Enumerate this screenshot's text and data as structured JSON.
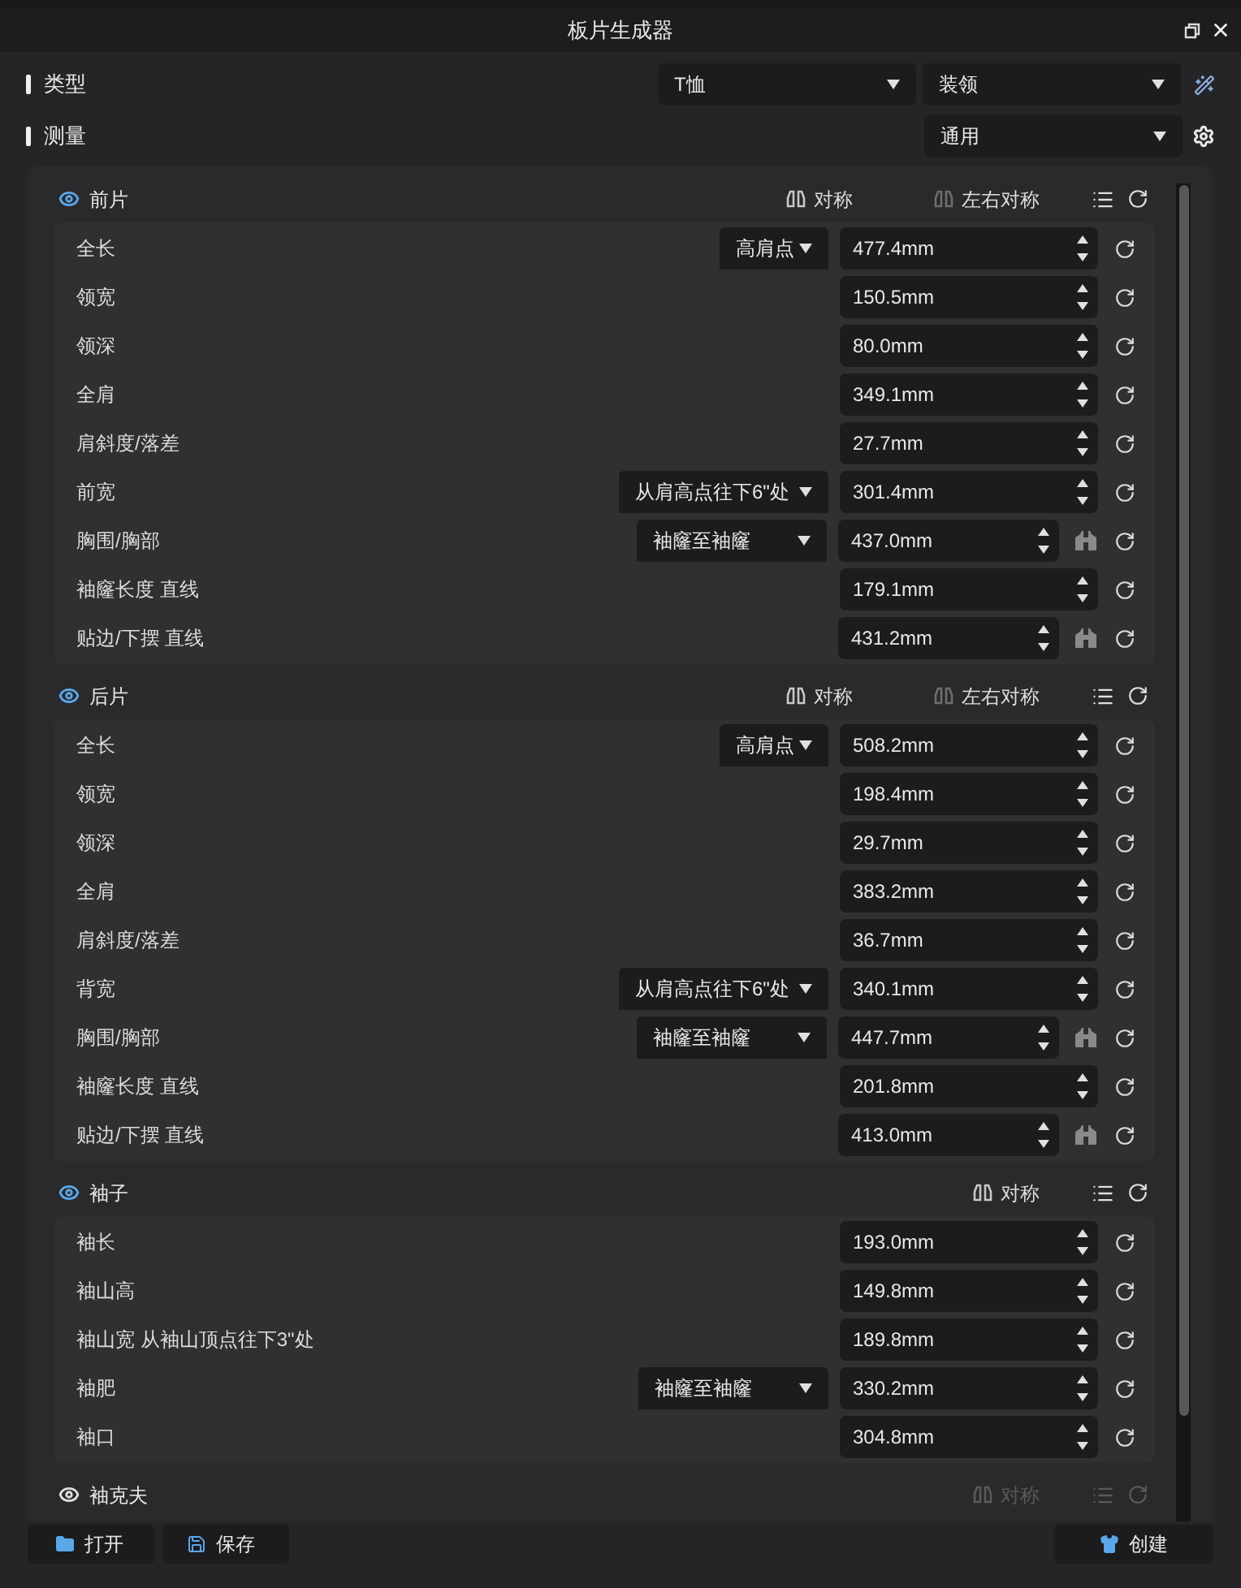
{
  "window": {
    "title": "板片生成器"
  },
  "type_row": {
    "label": "类型",
    "garment": "T恤",
    "collar": "装领"
  },
  "measure_row": {
    "label": "测量",
    "preset": "通用"
  },
  "sections": [
    {
      "title": "前片",
      "enabled": true,
      "toggles": [
        {
          "label": "对称",
          "on": true
        },
        {
          "label": "左右对称",
          "on": false
        }
      ],
      "rows": [
        {
          "label": "全长",
          "option": "高肩点",
          "value": "477.4mm",
          "figure": false
        },
        {
          "label": "领宽",
          "value": "150.5mm",
          "figure": false
        },
        {
          "label": "领深",
          "value": "80.0mm",
          "figure": false
        },
        {
          "label": "全肩",
          "value": "349.1mm",
          "figure": false
        },
        {
          "label": "肩斜度/落差",
          "value": "27.7mm",
          "figure": false
        },
        {
          "label": "前宽",
          "option": "从肩高点往下6\"处",
          "value": "301.4mm",
          "figure": false
        },
        {
          "label": "胸围/胸部",
          "option": "袖窿至袖窿",
          "value": "437.0mm",
          "figure": true
        },
        {
          "label": "袖窿长度 直线",
          "value": "179.1mm",
          "figure": false
        },
        {
          "label": "贴边/下摆 直线",
          "value": "431.2mm",
          "figure": true
        }
      ]
    },
    {
      "title": "后片",
      "enabled": true,
      "toggles": [
        {
          "label": "对称",
          "on": true
        },
        {
          "label": "左右对称",
          "on": false
        }
      ],
      "rows": [
        {
          "label": "全长",
          "option": "高肩点",
          "value": "508.2mm",
          "figure": false
        },
        {
          "label": "领宽",
          "value": "198.4mm",
          "figure": false
        },
        {
          "label": "领深",
          "value": "29.7mm",
          "figure": false
        },
        {
          "label": "全肩",
          "value": "383.2mm",
          "figure": false
        },
        {
          "label": "肩斜度/落差",
          "value": "36.7mm",
          "figure": false
        },
        {
          "label": "背宽",
          "option": "从肩高点往下6\"处",
          "value": "340.1mm",
          "figure": false
        },
        {
          "label": "胸围/胸部",
          "option": "袖窿至袖窿",
          "value": "447.7mm",
          "figure": true
        },
        {
          "label": "袖窿长度 直线",
          "value": "201.8mm",
          "figure": false
        },
        {
          "label": "贴边/下摆 直线",
          "value": "413.0mm",
          "figure": true
        }
      ]
    },
    {
      "title": "袖子",
      "enabled": true,
      "toggles": [
        {
          "label": "对称",
          "on": true
        }
      ],
      "rows": [
        {
          "label": "袖长",
          "value": "193.0mm",
          "figure": false
        },
        {
          "label": "袖山高",
          "value": "149.8mm",
          "figure": false
        },
        {
          "label": "袖山宽 从袖山顶点往下3\"处",
          "value": "189.8mm",
          "figure": false
        },
        {
          "label": "袖肥",
          "option": "袖窿至袖窿",
          "value": "330.2mm",
          "figure": false
        },
        {
          "label": "袖口",
          "value": "304.8mm",
          "figure": false
        }
      ]
    },
    {
      "title": "袖克夫",
      "enabled": false,
      "toggles": [
        {
          "label": "对称"
        }
      ]
    }
  ],
  "footer": {
    "open": "打开",
    "save": "保存",
    "create": "创建"
  }
}
